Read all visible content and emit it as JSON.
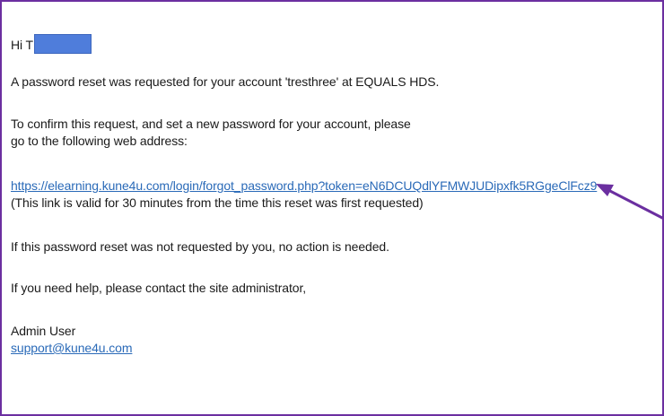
{
  "email": {
    "greeting": "Hi T",
    "request_line": "A password reset was requested for your account 'tresthree' at EQUALS HDS.",
    "confirm_line_1": "To confirm this request, and set a new password for your account, please",
    "confirm_line_2": "go to the following web address:",
    "reset_link": "https://elearning.kune4u.com/login/forgot_password.php?token=eN6DCUQdlYFMWJUDipxfk5RGgeClFcz9",
    "validity_note": "(This link is valid for 30 minutes from the time this reset was first requested)",
    "no_action_line": "If this password reset was not requested by you, no action is needed.",
    "help_line": "If you need help, please contact the site administrator,",
    "signature_name": "Admin User",
    "support_email": "support@kune4u.com"
  },
  "colors": {
    "frame_border": "#6b2fa0",
    "link": "#2a6ab8",
    "redaction": "#4f7ddb",
    "arrow": "#6b2fa0"
  },
  "annotations": {
    "arrow_icon": "arrow-pointing-left-icon"
  }
}
